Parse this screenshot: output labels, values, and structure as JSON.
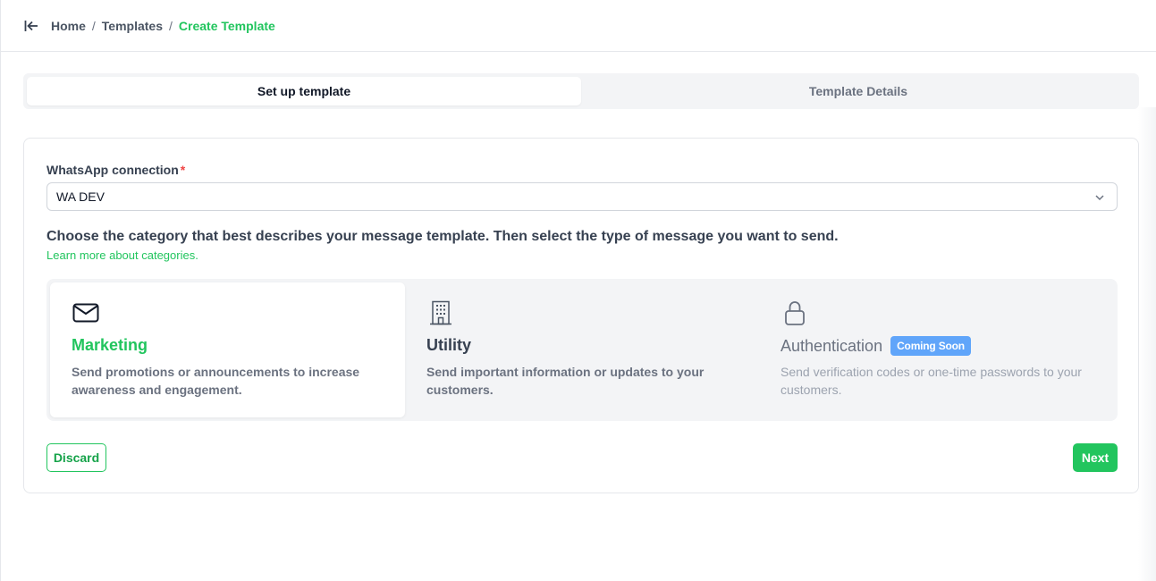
{
  "breadcrumb": {
    "home": "Home",
    "templates": "Templates",
    "current": "Create Template",
    "separator": "/"
  },
  "tabs": [
    {
      "label": "Set up template",
      "active": true
    },
    {
      "label": "Template Details",
      "active": false
    }
  ],
  "form": {
    "connection_label": "WhatsApp connection",
    "required_mark": "*",
    "connection_value": "WA DEV",
    "description": "Choose the category that best describes your message template. Then select the type of message you want to send.",
    "learn_more": "Learn more about categories."
  },
  "categories": [
    {
      "icon": "envelope-icon",
      "title": "Marketing",
      "text": "Send promotions or announcements to increase awareness and engagement.",
      "selected": true
    },
    {
      "icon": "building-icon",
      "title": "Utility",
      "text": "Send important information or updates to your customers.",
      "selected": false
    },
    {
      "icon": "lock-icon",
      "title": "Authentication",
      "badge": "Coming Soon",
      "text": "Send verification codes or one-time passwords to your customers.",
      "selected": false,
      "disabled": true
    }
  ],
  "actions": {
    "discard": "Discard",
    "next": "Next"
  },
  "colors": {
    "accent": "#22c55e",
    "badge": "#60a5fa",
    "required": "#ef4444"
  }
}
